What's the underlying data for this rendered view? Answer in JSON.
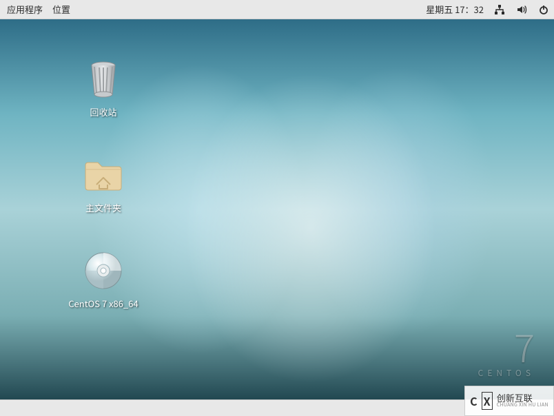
{
  "panel": {
    "applications_label": "应用程序",
    "places_label": "位置",
    "clock": "星期五 17：32"
  },
  "desktop": {
    "icons": [
      {
        "label": "回收站"
      },
      {
        "label": "主文件夹"
      },
      {
        "label": "CentOS 7 x86_64"
      }
    ],
    "watermark": {
      "version": "7",
      "brand": "CENTOS"
    }
  },
  "overlay": {
    "mark_left": "C",
    "mark_right": "X",
    "brand": "创新互联",
    "sub": "CHUANG XIN HU LIAN"
  }
}
